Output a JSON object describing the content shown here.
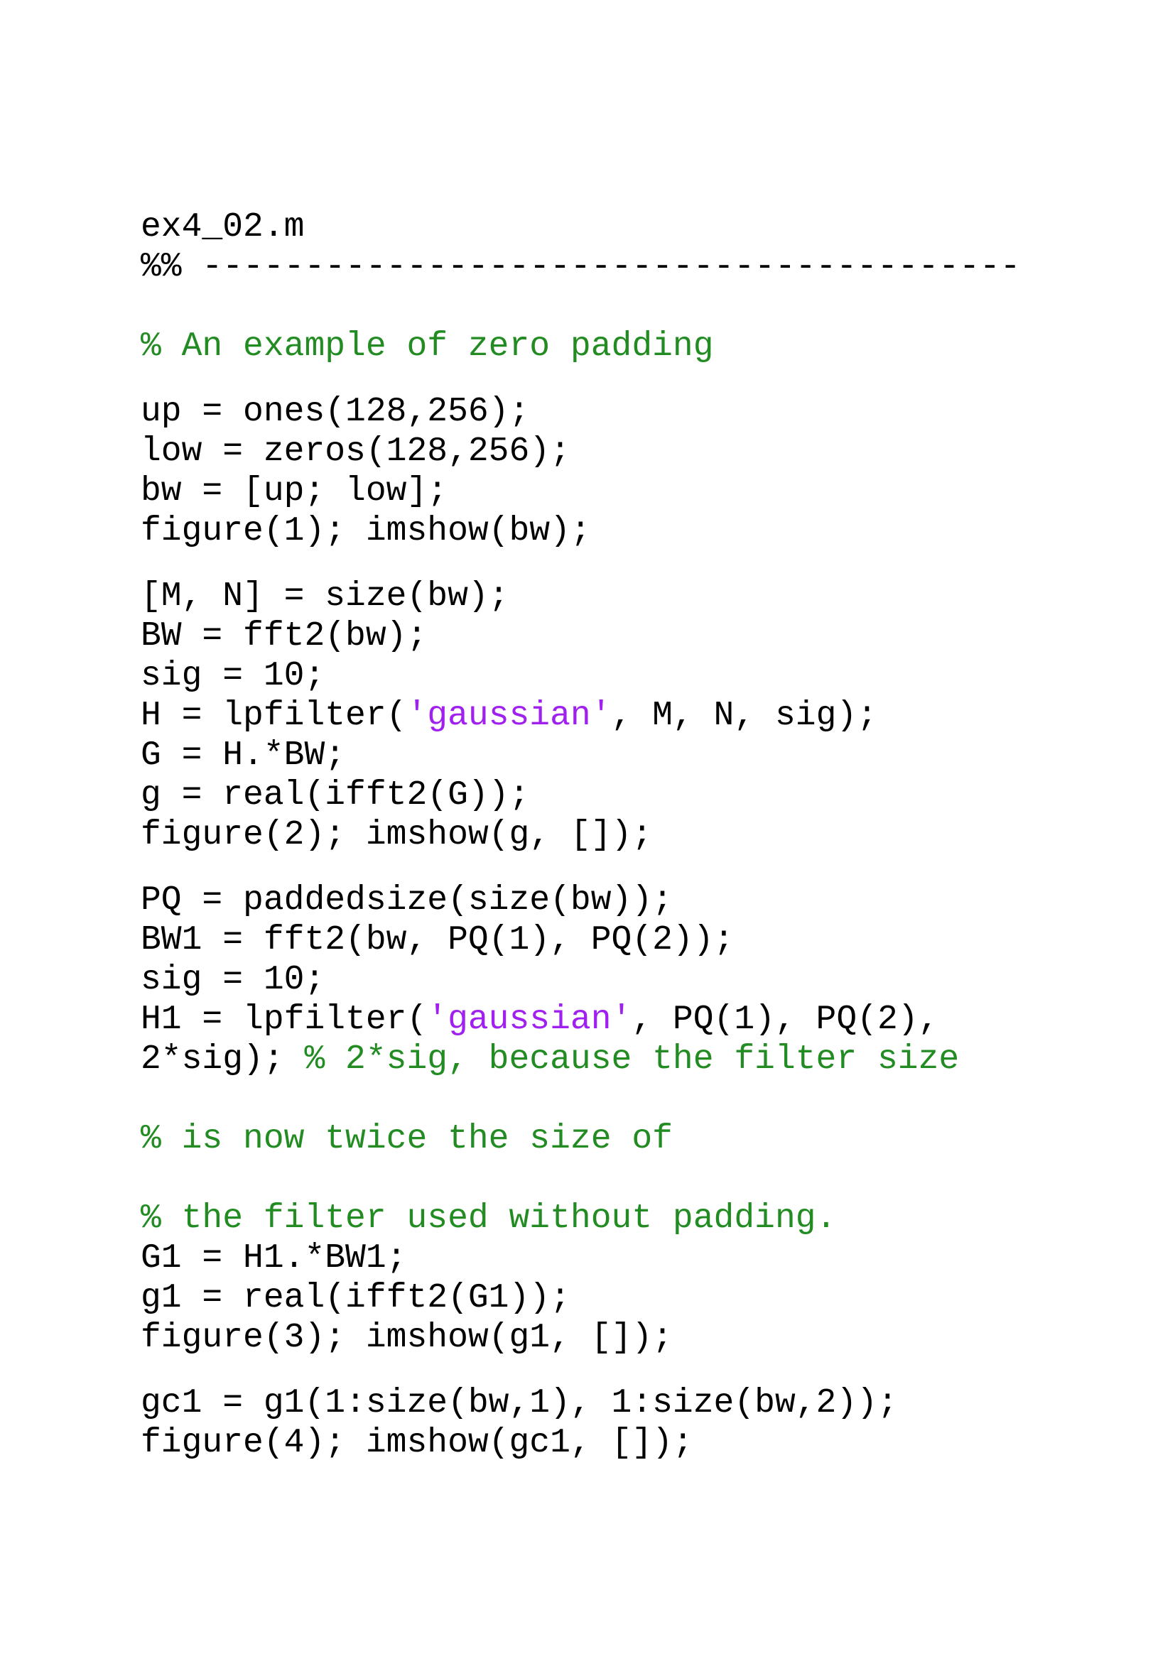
{
  "filename": "ex4_02.m",
  "section_divider": "%% ----------------------------------------",
  "colors": {
    "code": "#000000",
    "comment": "#228B22",
    "string": "#A020F0"
  },
  "lines": [
    [
      {
        "t": "% An example of zero padding",
        "k": "comment"
      }
    ],
    [
      {
        "t": "up = ones(128,256);",
        "k": "code"
      }
    ],
    [
      {
        "t": "low = zeros(128,256);",
        "k": "code"
      }
    ],
    [
      {
        "t": "bw = [up; low];",
        "k": "code"
      }
    ],
    [
      {
        "t": "figure(1); imshow(bw);",
        "k": "code"
      }
    ],
    [
      {
        "t": "[M, N] = size(bw);",
        "k": "code"
      }
    ],
    [
      {
        "t": "BW = fft2(bw);",
        "k": "code"
      }
    ],
    [
      {
        "t": "sig = 10;",
        "k": "code"
      }
    ],
    [
      {
        "t": "H = lpfilter(",
        "k": "code"
      },
      {
        "t": "'gaussian'",
        "k": "string"
      },
      {
        "t": ", M, N, sig);",
        "k": "code"
      }
    ],
    [
      {
        "t": "G = H.*BW;",
        "k": "code"
      }
    ],
    [
      {
        "t": "g = real(ifft2(G));",
        "k": "code"
      }
    ],
    [
      {
        "t": "figure(2); imshow(g, []);",
        "k": "code"
      }
    ],
    [
      {
        "t": "PQ = paddedsize(size(bw));",
        "k": "code"
      }
    ],
    [
      {
        "t": "BW1 = fft2(bw, PQ(1), PQ(2));",
        "k": "code"
      }
    ],
    [
      {
        "t": "sig = 10;",
        "k": "code"
      }
    ],
    [
      {
        "t": "H1 = lpfilter(",
        "k": "code"
      },
      {
        "t": "'gaussian'",
        "k": "string"
      },
      {
        "t": ", PQ(1), PQ(2),",
        "k": "code"
      }
    ],
    [
      {
        "t": "2*sig); ",
        "k": "code"
      },
      {
        "t": "% 2*sig, because the filter size",
        "k": "comment"
      }
    ],
    [
      {
        "t": "% is now twice the size of",
        "k": "comment"
      }
    ],
    [
      {
        "t": "% the filter used without padding.",
        "k": "comment"
      }
    ],
    [
      {
        "t": "G1 = H1.*BW1;",
        "k": "code"
      }
    ],
    [
      {
        "t": "g1 = real(ifft2(G1));",
        "k": "code"
      }
    ],
    [
      {
        "t": "figure(3); imshow(g1, []);",
        "k": "code"
      }
    ],
    [
      {
        "t": "gc1 = g1(1:size(bw,1), 1:size(bw,2));",
        "k": "code"
      }
    ],
    [
      {
        "t": "figure(4); imshow(gc1, []);",
        "k": "code"
      }
    ]
  ]
}
